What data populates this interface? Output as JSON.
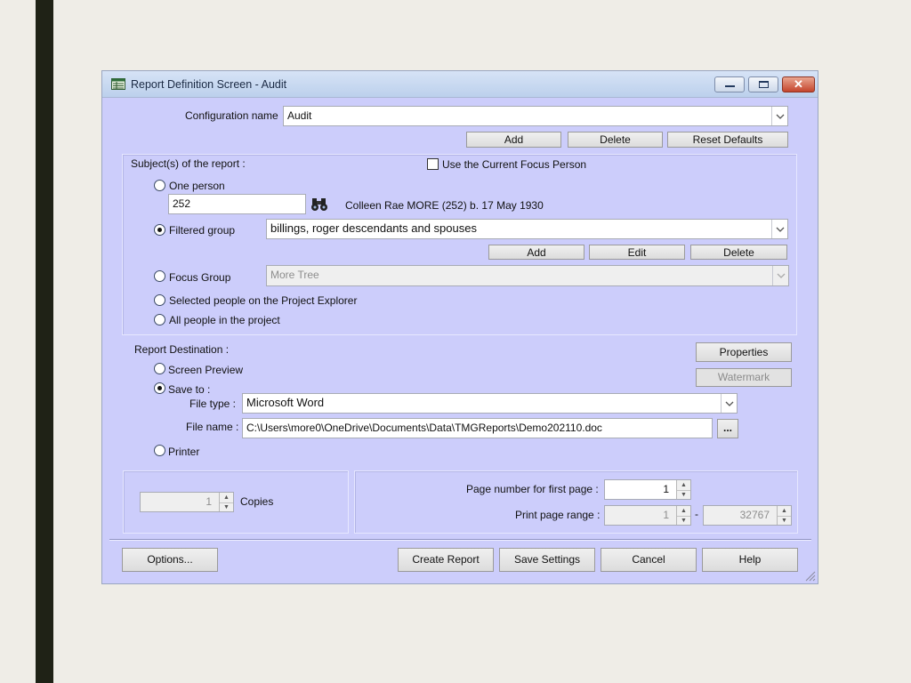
{
  "window": {
    "title": "Report Definition Screen - Audit"
  },
  "config": {
    "label": "Configuration name",
    "value": "Audit",
    "add_label": "Add",
    "delete_label": "Delete",
    "reset_label": "Reset Defaults"
  },
  "subjects": {
    "label": "Subject(s) of the report :",
    "use_focus_label": "Use the Current Focus Person",
    "use_focus_checked": false,
    "one_person_label": "One person",
    "person_id": "252",
    "person_desc": "Colleen Rae MORE (252) b. 17 May 1930",
    "filtered_group_label": "Filtered group",
    "filtered_group_value": "billings, roger descendants and spouses",
    "group_add_label": "Add",
    "group_edit_label": "Edit",
    "group_delete_label": "Delete",
    "focus_group_label": "Focus Group",
    "focus_group_value": "More Tree",
    "selected_people_label": "Selected people on the Project Explorer",
    "all_people_label": "All people in the project",
    "selected_option": "Filtered group"
  },
  "destination": {
    "label": "Report Destination :",
    "properties_label": "Properties",
    "watermark_label": "Watermark",
    "screen_preview_label": "Screen Preview",
    "save_to_label": "Save to :",
    "file_type_label": "File type :",
    "file_type_value": "Microsoft Word",
    "file_name_label": "File name :",
    "file_name_value": "C:\\Users\\more0\\OneDrive\\Documents\\Data\\TMGReports\\Demo202110.doc",
    "browse_label": "...",
    "printer_label": "Printer",
    "selected_option": "Save to"
  },
  "copies": {
    "value": "1",
    "label": "Copies"
  },
  "pages": {
    "first_page_label": "Page number for first page :",
    "first_page_value": "1",
    "range_label": "Print page range :",
    "range_from": "1",
    "range_sep": "-",
    "range_to": "32767"
  },
  "footer": {
    "options_label": "Options...",
    "create_label": "Create Report",
    "save_label": "Save Settings",
    "cancel_label": "Cancel",
    "help_label": "Help"
  },
  "icons": [
    "report-icon",
    "minimize-icon",
    "maximize-icon",
    "close-icon",
    "chevron-down-icon",
    "binoculars-icon",
    "spin-up-icon",
    "spin-down-icon",
    "resize-grip-icon"
  ]
}
